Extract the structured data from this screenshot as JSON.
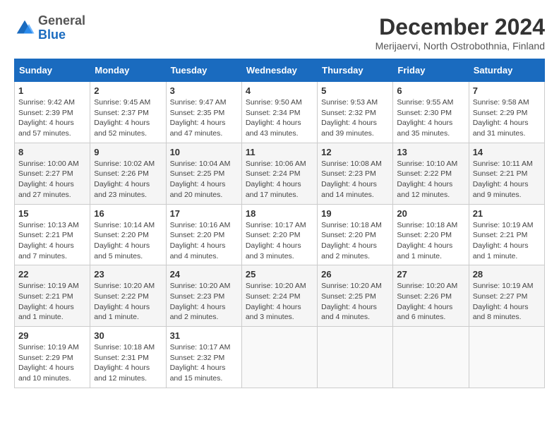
{
  "logo": {
    "general": "General",
    "blue": "Blue"
  },
  "title": "December 2024",
  "subtitle": "Merijaervi, North Ostrobothnia, Finland",
  "days_of_week": [
    "Sunday",
    "Monday",
    "Tuesday",
    "Wednesday",
    "Thursday",
    "Friday",
    "Saturday"
  ],
  "weeks": [
    [
      {
        "day": "1",
        "sunrise": "9:42 AM",
        "sunset": "2:39 PM",
        "daylight": "4 hours and 57 minutes."
      },
      {
        "day": "2",
        "sunrise": "9:45 AM",
        "sunset": "2:37 PM",
        "daylight": "4 hours and 52 minutes."
      },
      {
        "day": "3",
        "sunrise": "9:47 AM",
        "sunset": "2:35 PM",
        "daylight": "4 hours and 47 minutes."
      },
      {
        "day": "4",
        "sunrise": "9:50 AM",
        "sunset": "2:34 PM",
        "daylight": "4 hours and 43 minutes."
      },
      {
        "day": "5",
        "sunrise": "9:53 AM",
        "sunset": "2:32 PM",
        "daylight": "4 hours and 39 minutes."
      },
      {
        "day": "6",
        "sunrise": "9:55 AM",
        "sunset": "2:30 PM",
        "daylight": "4 hours and 35 minutes."
      },
      {
        "day": "7",
        "sunrise": "9:58 AM",
        "sunset": "2:29 PM",
        "daylight": "4 hours and 31 minutes."
      }
    ],
    [
      {
        "day": "8",
        "sunrise": "10:00 AM",
        "sunset": "2:27 PM",
        "daylight": "4 hours and 27 minutes."
      },
      {
        "day": "9",
        "sunrise": "10:02 AM",
        "sunset": "2:26 PM",
        "daylight": "4 hours and 23 minutes."
      },
      {
        "day": "10",
        "sunrise": "10:04 AM",
        "sunset": "2:25 PM",
        "daylight": "4 hours and 20 minutes."
      },
      {
        "day": "11",
        "sunrise": "10:06 AM",
        "sunset": "2:24 PM",
        "daylight": "4 hours and 17 minutes."
      },
      {
        "day": "12",
        "sunrise": "10:08 AM",
        "sunset": "2:23 PM",
        "daylight": "4 hours and 14 minutes."
      },
      {
        "day": "13",
        "sunrise": "10:10 AM",
        "sunset": "2:22 PM",
        "daylight": "4 hours and 12 minutes."
      },
      {
        "day": "14",
        "sunrise": "10:11 AM",
        "sunset": "2:21 PM",
        "daylight": "4 hours and 9 minutes."
      }
    ],
    [
      {
        "day": "15",
        "sunrise": "10:13 AM",
        "sunset": "2:21 PM",
        "daylight": "4 hours and 7 minutes."
      },
      {
        "day": "16",
        "sunrise": "10:14 AM",
        "sunset": "2:20 PM",
        "daylight": "4 hours and 5 minutes."
      },
      {
        "day": "17",
        "sunrise": "10:16 AM",
        "sunset": "2:20 PM",
        "daylight": "4 hours and 4 minutes."
      },
      {
        "day": "18",
        "sunrise": "10:17 AM",
        "sunset": "2:20 PM",
        "daylight": "4 hours and 3 minutes."
      },
      {
        "day": "19",
        "sunrise": "10:18 AM",
        "sunset": "2:20 PM",
        "daylight": "4 hours and 2 minutes."
      },
      {
        "day": "20",
        "sunrise": "10:18 AM",
        "sunset": "2:20 PM",
        "daylight": "4 hours and 1 minute."
      },
      {
        "day": "21",
        "sunrise": "10:19 AM",
        "sunset": "2:21 PM",
        "daylight": "4 hours and 1 minute."
      }
    ],
    [
      {
        "day": "22",
        "sunrise": "10:19 AM",
        "sunset": "2:21 PM",
        "daylight": "4 hours and 1 minute."
      },
      {
        "day": "23",
        "sunrise": "10:20 AM",
        "sunset": "2:22 PM",
        "daylight": "4 hours and 1 minute."
      },
      {
        "day": "24",
        "sunrise": "10:20 AM",
        "sunset": "2:23 PM",
        "daylight": "4 hours and 2 minutes."
      },
      {
        "day": "25",
        "sunrise": "10:20 AM",
        "sunset": "2:24 PM",
        "daylight": "4 hours and 3 minutes."
      },
      {
        "day": "26",
        "sunrise": "10:20 AM",
        "sunset": "2:25 PM",
        "daylight": "4 hours and 4 minutes."
      },
      {
        "day": "27",
        "sunrise": "10:20 AM",
        "sunset": "2:26 PM",
        "daylight": "4 hours and 6 minutes."
      },
      {
        "day": "28",
        "sunrise": "10:19 AM",
        "sunset": "2:27 PM",
        "daylight": "4 hours and 8 minutes."
      }
    ],
    [
      {
        "day": "29",
        "sunrise": "10:19 AM",
        "sunset": "2:29 PM",
        "daylight": "4 hours and 10 minutes."
      },
      {
        "day": "30",
        "sunrise": "10:18 AM",
        "sunset": "2:31 PM",
        "daylight": "4 hours and 12 minutes."
      },
      {
        "day": "31",
        "sunrise": "10:17 AM",
        "sunset": "2:32 PM",
        "daylight": "4 hours and 15 minutes."
      },
      null,
      null,
      null,
      null
    ]
  ]
}
